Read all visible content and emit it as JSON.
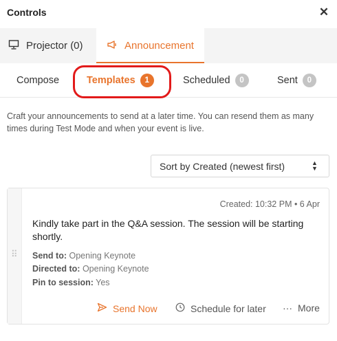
{
  "header": {
    "title": "Controls",
    "close_icon": "close-icon"
  },
  "tabs": {
    "projector_label": "Projector (0)",
    "announcement_label": "Announcement",
    "active": "announcement"
  },
  "subtabs": {
    "compose_label": "Compose",
    "templates_label": "Templates",
    "templates_count": "1",
    "scheduled_label": "Scheduled",
    "scheduled_count": "0",
    "sent_label": "Sent",
    "sent_count": "0",
    "active": "templates"
  },
  "description": "Craft your announcements to send at a later time. You can resend them as many times during Test Mode and when your event is live.",
  "sort": {
    "selected": "Sort by Created (newest first)"
  },
  "template_card": {
    "created": "Created: 10:32 PM • 6 Apr",
    "message": "Kindly take part in the Q&A session. The session will be starting shortly.",
    "send_to_label": "Send to:",
    "send_to_value": "Opening Keynote",
    "directed_to_label": "Directed to:",
    "directed_to_value": "Opening Keynote",
    "pin_label": "Pin to session:",
    "pin_value": "Yes",
    "send_now_label": "Send Now",
    "schedule_label": "Schedule for later",
    "more_label": "More"
  },
  "colors": {
    "accent": "#e8742c",
    "highlight": "#e21a1a",
    "badge_grey": "#c4c4c4"
  }
}
